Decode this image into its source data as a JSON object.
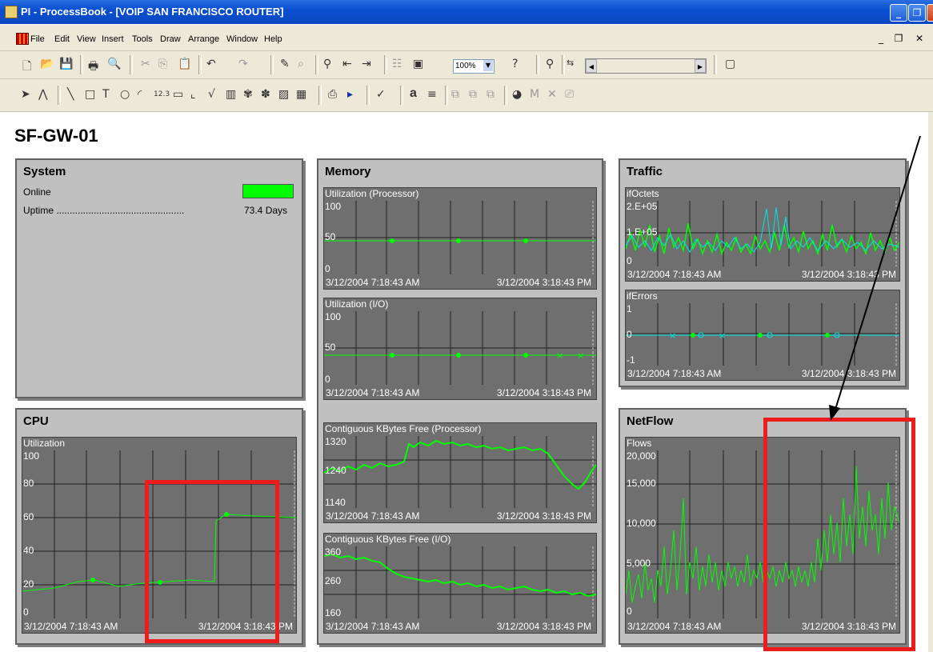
{
  "window": {
    "title": "PI - ProcessBook - [VOIP SAN FRANCISCO ROUTER]"
  },
  "menu": [
    "File",
    "Edit",
    "View",
    "Insert",
    "Tools",
    "Draw",
    "Arrange",
    "Window",
    "Help"
  ],
  "toolbar": {
    "zoom": "100%"
  },
  "page_title": "SF-GW-01",
  "system": {
    "title": "System",
    "online_label": "Online",
    "uptime_label": "Uptime ................................................",
    "uptime_value": "73.4 Days",
    "status_color": "#00ff00"
  },
  "memory": {
    "title": "Memory"
  },
  "traffic": {
    "title": "Traffic"
  },
  "cpu": {
    "title": "CPU"
  },
  "netflow": {
    "title": "NetFlow"
  },
  "time_start": "3/12/2004 7:18:43 AM",
  "time_end": "3/12/2004 3:18:43 PM",
  "trends": {
    "mem_util_proc": {
      "label": "Utilization (Processor)",
      "y": [
        "100",
        "50",
        "0"
      ]
    },
    "mem_util_io": {
      "label": "Utilization (I/O)",
      "y": [
        "100",
        "50",
        "0"
      ]
    },
    "mem_kb_proc": {
      "label": "Contiguous KBytes Free (Processor)",
      "y": [
        "1320",
        "1240",
        "1140"
      ]
    },
    "mem_kb_io": {
      "label": "Contiguous KBytes Free (I/O)",
      "y": [
        "360",
        "260",
        "160"
      ]
    },
    "if_octets": {
      "label": "ifOctets",
      "y": [
        "2.E+05",
        "1.E+05",
        "0"
      ]
    },
    "if_errors": {
      "label": "ifErrors",
      "y": [
        "1",
        "0",
        "-1"
      ]
    },
    "cpu_util": {
      "label": "Utilization",
      "y": [
        "100",
        "80",
        "60",
        "40",
        "20",
        "0"
      ]
    },
    "flows": {
      "label": "Flows",
      "y": [
        "20,000",
        "15,000",
        "10,000",
        "5,000",
        "0"
      ]
    }
  },
  "chart_data": [
    {
      "type": "line",
      "title": "Utilization (Processor)",
      "ylim": [
        0,
        100
      ],
      "series": [
        {
          "values": [
            40,
            40,
            40,
            40,
            40,
            40,
            40,
            40,
            40,
            40
          ]
        }
      ]
    },
    {
      "type": "line",
      "title": "Utilization (I/O)",
      "ylim": [
        0,
        100
      ],
      "series": [
        {
          "values": [
            40,
            40,
            40,
            40,
            40,
            40,
            40,
            40,
            40,
            40
          ]
        }
      ]
    },
    {
      "type": "line",
      "title": "Utilization",
      "ylim": [
        0,
        100
      ],
      "series": [
        {
          "values": [
            16,
            18,
            22,
            16,
            20,
            21,
            20,
            58,
            57,
            56,
            55,
            56
          ]
        }
      ]
    },
    {
      "type": "line",
      "title": "Flows",
      "ylim": [
        0,
        20000
      ],
      "series": [
        {
          "values": [
            2000,
            4500,
            6000,
            5500,
            4000,
            6500,
            5500,
            7000,
            5500,
            9000,
            13000,
            8000,
            11000,
            12500,
            10000,
            9500
          ]
        }
      ]
    }
  ]
}
